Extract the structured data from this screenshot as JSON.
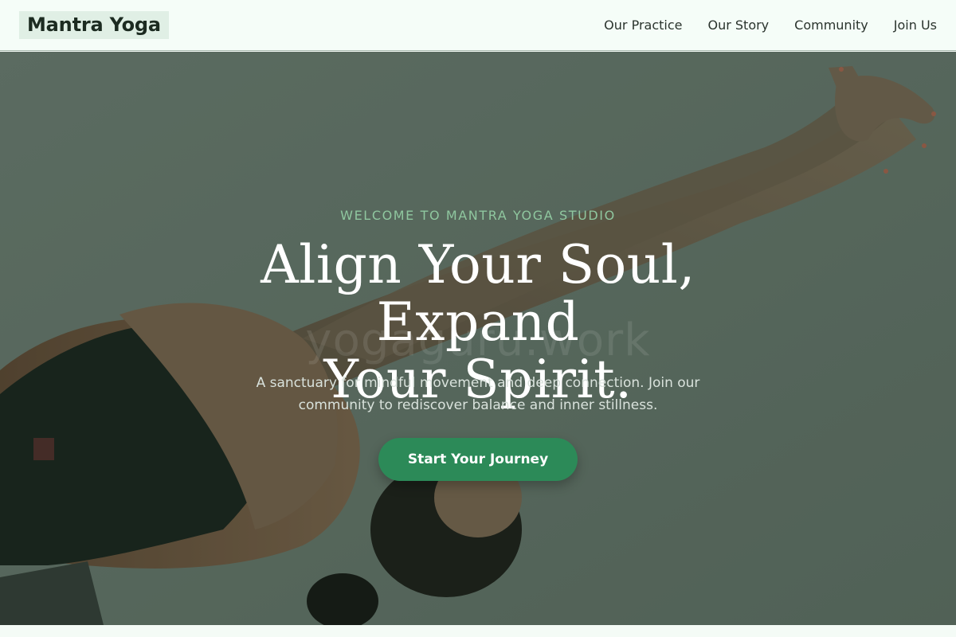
{
  "brand": {
    "name": "Mantra Yoga"
  },
  "nav": {
    "links": [
      {
        "label": "Our Practice"
      },
      {
        "label": "Our Story"
      },
      {
        "label": "Community"
      },
      {
        "label": "Join Us"
      }
    ]
  },
  "hero": {
    "eyebrow": "WELCOME TO MANTRA YOGA STUDIO",
    "headline_line1": "Align Your Soul, Expand",
    "headline_line2": "Your Spirit.",
    "subtext_line1": "A sanctuary for mindful movement and deep connection. Join our",
    "subtext_line2": "community to rediscover balance and inner stillness.",
    "cta_label": "Start Your Journey",
    "watermark": "yogaguru.work"
  },
  "colors": {
    "accent": "#2c8a58",
    "eyebrow": "#8fc79f",
    "nav_background": "#f5fdf8",
    "brand_background": "#e0efe5"
  }
}
